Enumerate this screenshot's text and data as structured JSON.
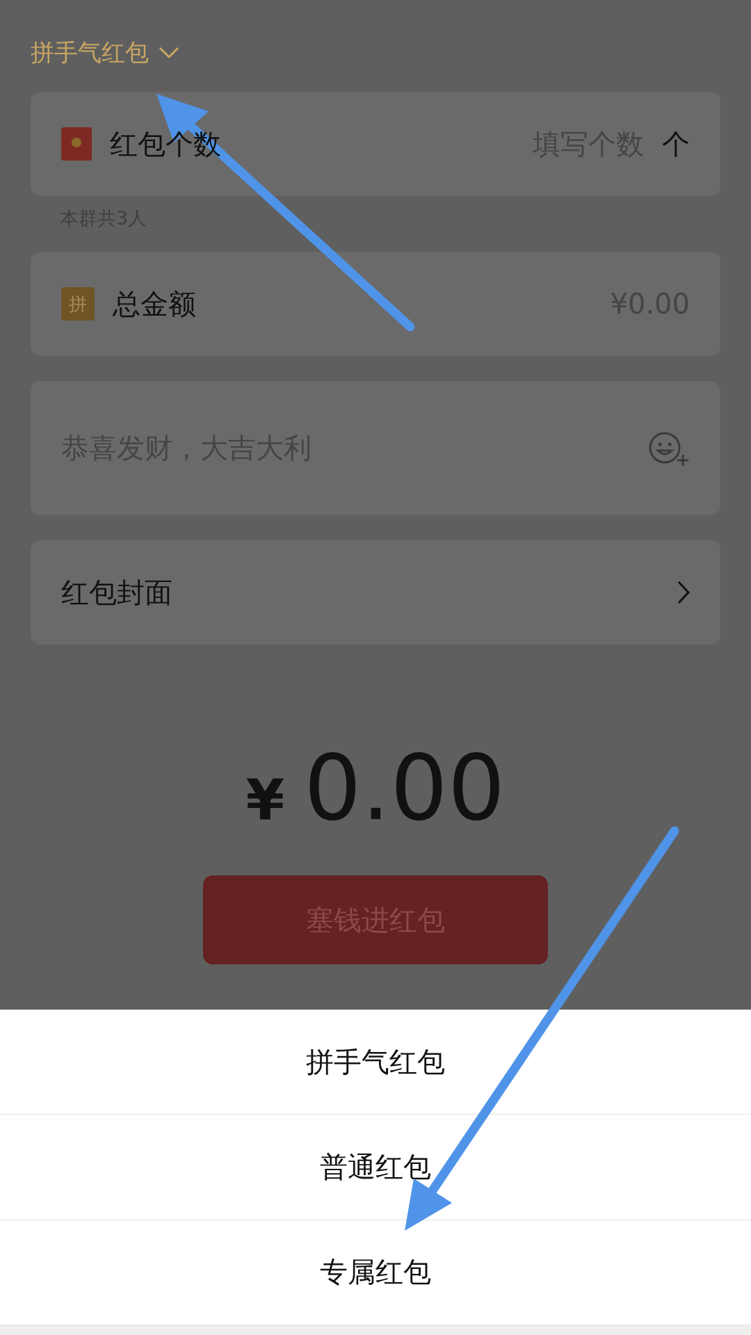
{
  "header": {
    "title": "拼手气红包"
  },
  "count_field": {
    "label": "红包个数",
    "placeholder": "填写个数",
    "unit": "个"
  },
  "member_note": "本群共3人",
  "amount_field": {
    "badge": "拼",
    "label": "总金额",
    "placeholder": "¥0.00"
  },
  "greeting_field": {
    "placeholder": "恭喜发财，大吉大利"
  },
  "cover_row": {
    "label": "红包封面"
  },
  "total": {
    "currency": "¥",
    "amount": "0.00"
  },
  "submit_button": "塞钱进红包",
  "type_sheet": {
    "options": [
      "拼手气红包",
      "普通红包",
      "专属红包"
    ]
  }
}
